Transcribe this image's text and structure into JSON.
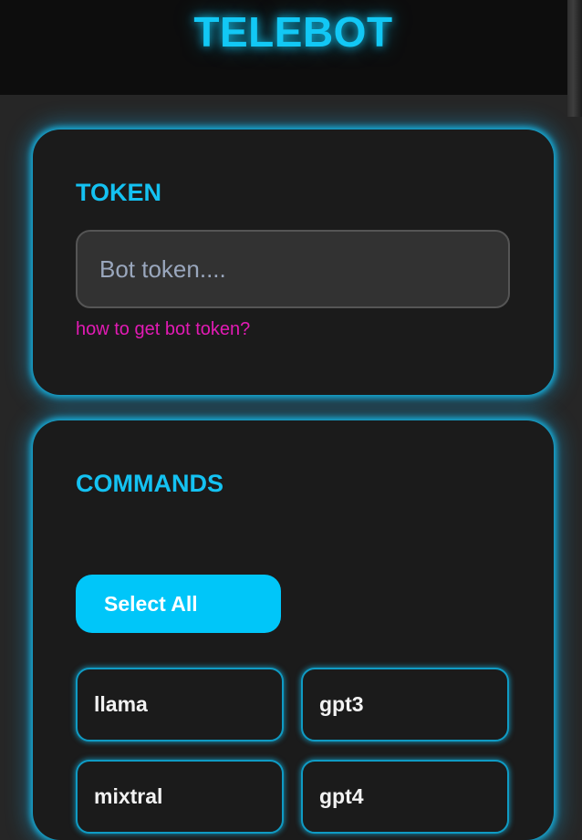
{
  "header": {
    "title": "TELEBOT"
  },
  "token_card": {
    "title": "TOKEN",
    "input_placeholder": "Bot token....",
    "input_value": "",
    "help_link": "how to get bot token?"
  },
  "commands_card": {
    "title": "COMMANDS",
    "select_all_label": "Select All",
    "commands": [
      {
        "label": "llama"
      },
      {
        "label": "gpt3"
      },
      {
        "label": "mixtral"
      },
      {
        "label": "gpt4"
      }
    ]
  },
  "colors": {
    "accent": "#12c8f5",
    "button": "#00c6f9",
    "link": "#e21bb4",
    "card_bg": "#1b1b1b",
    "page_bg": "#262626"
  }
}
